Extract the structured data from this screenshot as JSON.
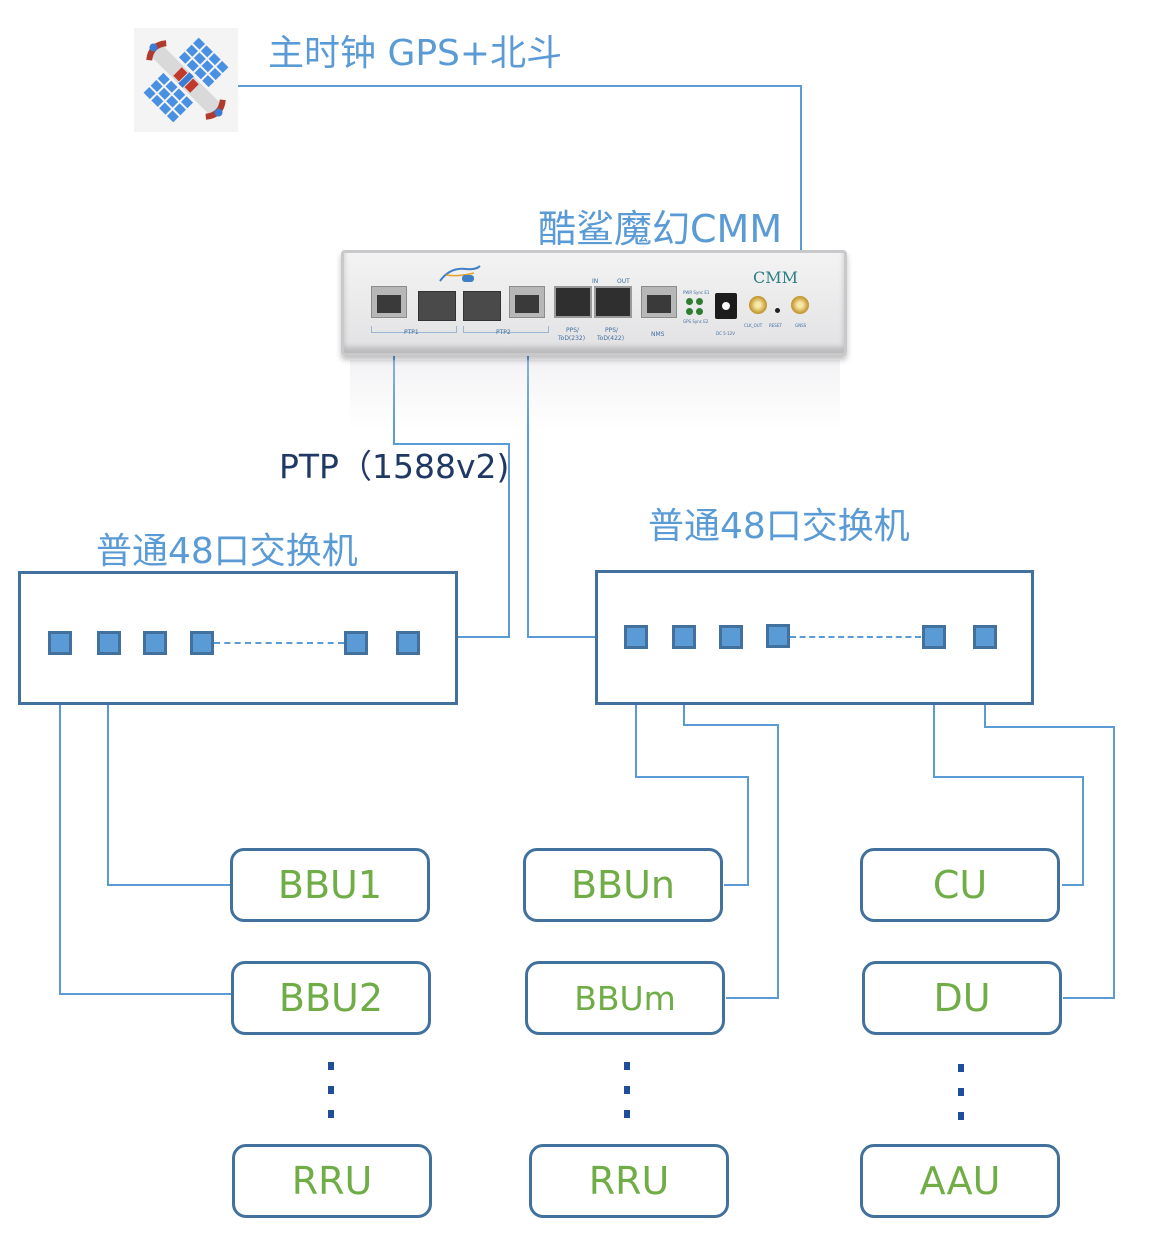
{
  "diagram": {
    "title": "CMM PTP clock distribution topology",
    "colors": {
      "line": "#5b9bd5",
      "box_border": "#41719c",
      "node_text": "#70ad47",
      "label_blue": "#5b9bd5",
      "ptp_label": "#1f3864",
      "dots": "#1f4e9c"
    }
  },
  "gps": {
    "icon": "satellite-icon",
    "label": "主时钟 GPS+北斗"
  },
  "device": {
    "title": "酷鲨魔幻CMM",
    "brand": "CMM",
    "ports": {
      "ptp1": "PTP1",
      "ptp2": "PTP2",
      "in": "IN",
      "out": "OUT",
      "pps232_a": "PPS/",
      "pps232_b": "ToD(232)",
      "pps422_a": "PPS/",
      "pps422_b": "ToD(422)",
      "nms": "NMS",
      "pwr": "PWR Sync E1",
      "gps": "GPS Sync E2",
      "dc": "DC 5-12V",
      "clk_out": "CLK_OUT",
      "reset": "RESET",
      "gnss": "GNSS"
    }
  },
  "link_label": "PTP（1588v2)",
  "switches": [
    {
      "id": "left",
      "label": "普通48口交换机"
    },
    {
      "id": "right",
      "label": "普通48口交换机"
    }
  ],
  "nodes": {
    "col1": [
      "BBU1",
      "BBU2",
      "RRU"
    ],
    "col2": [
      "BBUn",
      "BBUm",
      "RRU"
    ],
    "col3": [
      "CU",
      "DU",
      "AAU"
    ]
  }
}
